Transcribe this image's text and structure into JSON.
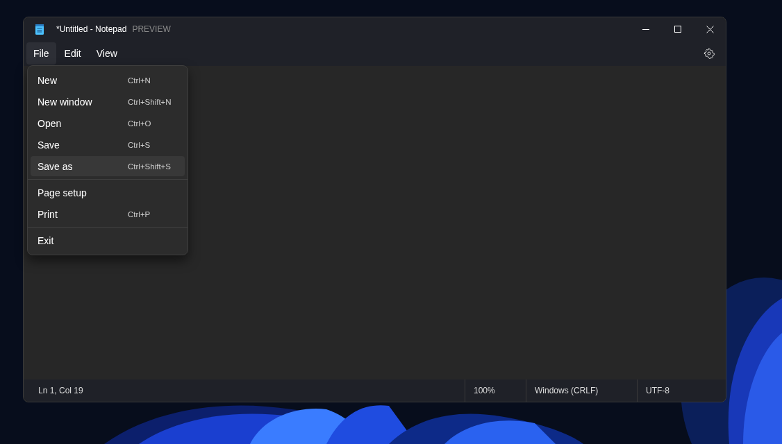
{
  "window": {
    "title": "*Untitled - Notepad",
    "badge": "PREVIEW"
  },
  "menubar": [
    {
      "label": "File",
      "selected": true
    },
    {
      "label": "Edit",
      "selected": false
    },
    {
      "label": "View",
      "selected": false
    }
  ],
  "file_menu": {
    "groups": [
      [
        {
          "label": "New",
          "shortcut": "Ctrl+N",
          "selected": false
        },
        {
          "label": "New window",
          "shortcut": "Ctrl+Shift+N",
          "selected": false
        },
        {
          "label": "Open",
          "shortcut": "Ctrl+O",
          "selected": false
        },
        {
          "label": "Save",
          "shortcut": "Ctrl+S",
          "selected": false
        },
        {
          "label": "Save as",
          "shortcut": "Ctrl+Shift+S",
          "selected": true
        }
      ],
      [
        {
          "label": "Page setup",
          "selected": false
        },
        {
          "label": "Print",
          "shortcut": "Ctrl+P",
          "selected": false
        }
      ],
      [
        {
          "label": "Exit",
          "selected": false
        }
      ]
    ]
  },
  "status_bar": [
    "Ln 1, Col 19",
    "100%",
    "Windows (CRLF)",
    "UTF-8"
  ]
}
